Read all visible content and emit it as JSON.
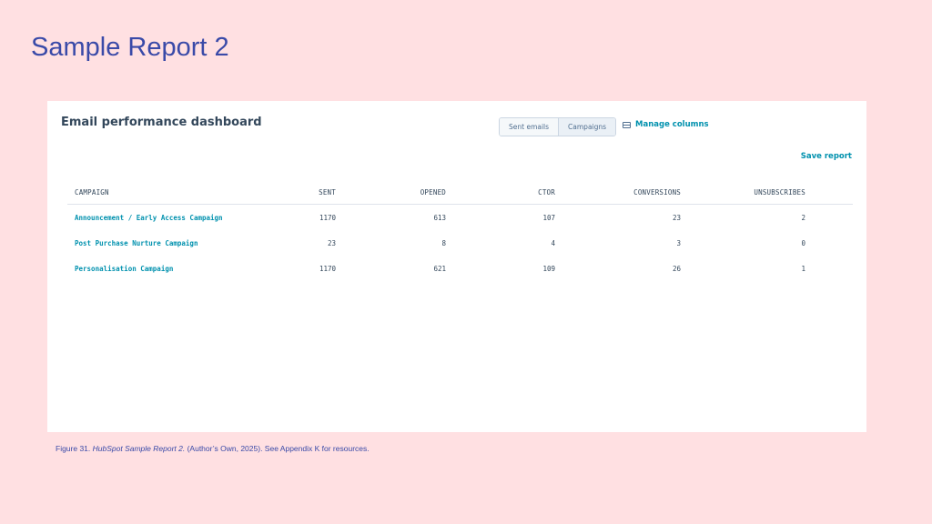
{
  "slide": {
    "title": "Sample Report 2"
  },
  "dashboard": {
    "title": "Email performance dashboard",
    "toggle": {
      "sent_emails": "Sent emails",
      "campaigns": "Campaigns",
      "selected": "Campaigns"
    },
    "manage_columns": "Manage columns",
    "save_report": "Save report"
  },
  "table": {
    "headers": {
      "campaign": "CAMPAIGN",
      "sent": "SENT",
      "opened": "OPENED",
      "ctor": "CTOR",
      "conversions": "CONVERSIONS",
      "unsubscribes": "UNSUBSCRIBES"
    },
    "rows": [
      {
        "campaign": "Announcement / Early Access Campaign",
        "sent": "1170",
        "opened": "613",
        "ctor": "107",
        "conversions": "23",
        "unsubscribes": "2"
      },
      {
        "campaign": "Post Purchase Nurture Campaign",
        "sent": "23",
        "opened": "8",
        "ctor": "4",
        "conversions": "3",
        "unsubscribes": "0"
      },
      {
        "campaign": "Personalisation Campaign",
        "sent": "1170",
        "opened": "621",
        "ctor": "109",
        "conversions": "26",
        "unsubscribes": "1"
      }
    ]
  },
  "caption": {
    "prefix": "Figure 31. ",
    "italic": "HubSpot Sample Report 2.",
    "suffix": " (Author’s Own, 2025). See Appendix K for resources."
  },
  "colors": {
    "background": "#ffe0e2",
    "title": "#3a4aa8",
    "link": "#0091ae",
    "text": "#33475b"
  }
}
